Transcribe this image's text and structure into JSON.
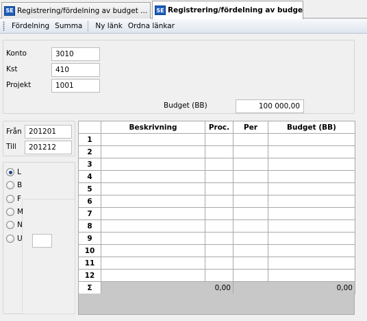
{
  "tabs": [
    {
      "icon": "SE",
      "label": "Registrering/fördelning av budget ..."
    },
    {
      "icon": "SE",
      "label": "Registrering/fördelning av budge..."
    }
  ],
  "toolbar": {
    "fordelning": "Fördelning",
    "summa": "Summa",
    "ny_lank": "Ny länk",
    "ordna_lankar": "Ordna länkar"
  },
  "header": {
    "konto_label": "Konto",
    "konto_value": "3010",
    "kst_label": "Kst",
    "kst_value": "410",
    "projekt_label": "Projekt",
    "projekt_value": "1001",
    "budget_label": "Budget (BB)",
    "budget_value": "100 000,00"
  },
  "period": {
    "fran_label": "Från",
    "fran_value": "201201",
    "till_label": "Till",
    "till_value": "201212"
  },
  "radios": [
    {
      "label": "L",
      "checked": true
    },
    {
      "label": "B",
      "checked": false
    },
    {
      "label": "F",
      "checked": false
    },
    {
      "label": "M",
      "checked": false
    },
    {
      "label": "N",
      "checked": false
    },
    {
      "label": "U",
      "checked": false
    }
  ],
  "grid": {
    "columns": [
      "Beskrivning",
      "Proc.",
      "Per",
      "Budget (BB)"
    ],
    "rows": [
      "1",
      "2",
      "3",
      "4",
      "5",
      "6",
      "7",
      "8",
      "9",
      "10",
      "11",
      "12"
    ],
    "sum_symbol": "Σ",
    "sum_proc": "0,00",
    "sum_budget": "0,00"
  }
}
